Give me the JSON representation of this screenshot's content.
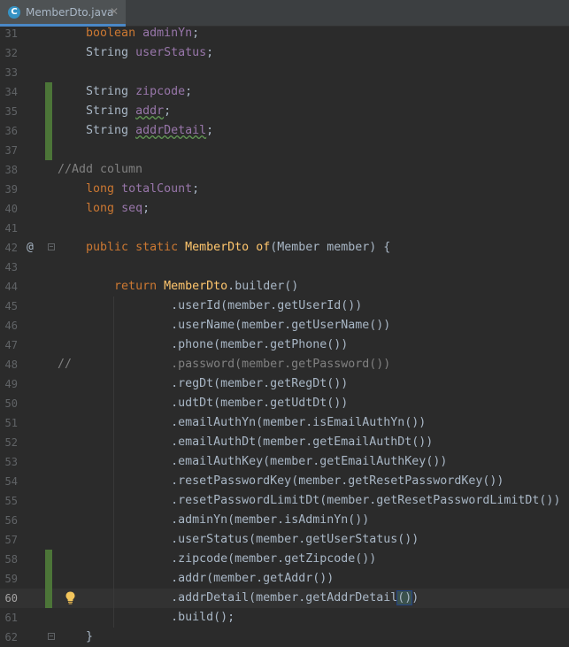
{
  "tab": {
    "filename": "MemberDto.java",
    "icon_letter": "C",
    "close_glyph": "✕"
  },
  "lines": [
    {
      "num": "31",
      "tokens": [
        {
          "t": "    "
        },
        {
          "t": "boolean",
          "c": "kw"
        },
        {
          "t": " "
        },
        {
          "t": "adminYn",
          "c": "fld"
        },
        {
          "t": ";"
        }
      ]
    },
    {
      "num": "32",
      "tokens": [
        {
          "t": "    String "
        },
        {
          "t": "userStatus",
          "c": "fld"
        },
        {
          "t": ";"
        }
      ]
    },
    {
      "num": "33",
      "tokens": []
    },
    {
      "num": "34",
      "change": true,
      "tokens": [
        {
          "t": "    String "
        },
        {
          "t": "zipcode",
          "c": "fld"
        },
        {
          "t": ";"
        }
      ]
    },
    {
      "num": "35",
      "change": true,
      "tokens": [
        {
          "t": "    String "
        },
        {
          "t": "addr",
          "c": "fld wavy"
        },
        {
          "t": ";"
        }
      ]
    },
    {
      "num": "36",
      "change": true,
      "tokens": [
        {
          "t": "    String "
        },
        {
          "t": "addrDetail",
          "c": "fld wavy"
        },
        {
          "t": ";"
        }
      ]
    },
    {
      "num": "37",
      "change": true,
      "tokens": []
    },
    {
      "num": "38",
      "tokens": [
        {
          "t": "//Add column",
          "c": "cmt"
        }
      ]
    },
    {
      "num": "39",
      "tokens": [
        {
          "t": "    "
        },
        {
          "t": "long",
          "c": "kw"
        },
        {
          "t": " "
        },
        {
          "t": "totalCount",
          "c": "fld"
        },
        {
          "t": ";"
        }
      ]
    },
    {
      "num": "40",
      "tokens": [
        {
          "t": "    "
        },
        {
          "t": "long",
          "c": "kw"
        },
        {
          "t": " "
        },
        {
          "t": "seq",
          "c": "fld"
        },
        {
          "t": ";"
        }
      ]
    },
    {
      "num": "41",
      "tokens": []
    },
    {
      "num": "42",
      "gutter": "@",
      "fold": true,
      "tokens": [
        {
          "t": "    "
        },
        {
          "t": "public static",
          "c": "kw"
        },
        {
          "t": " "
        },
        {
          "t": "MemberDto",
          "c": "mth"
        },
        {
          "t": " "
        },
        {
          "t": "of",
          "c": "mth"
        },
        {
          "t": "(Member member) {"
        }
      ]
    },
    {
      "num": "43",
      "tokens": []
    },
    {
      "num": "44",
      "tokens": [
        {
          "t": "        "
        },
        {
          "t": "return",
          "c": "kw"
        },
        {
          "t": " "
        },
        {
          "t": "MemberDto",
          "c": "mth"
        },
        {
          "t": "."
        },
        {
          "t": "builder",
          "c": "call"
        },
        {
          "t": "()"
        }
      ]
    },
    {
      "num": "45",
      "tokens": [
        {
          "t": "                ."
        },
        {
          "t": "userId",
          "c": "call"
        },
        {
          "t": "(member."
        },
        {
          "t": "getUserId",
          "c": "call"
        },
        {
          "t": "())"
        }
      ]
    },
    {
      "num": "46",
      "tokens": [
        {
          "t": "                ."
        },
        {
          "t": "userName",
          "c": "call"
        },
        {
          "t": "(member."
        },
        {
          "t": "getUserName",
          "c": "call"
        },
        {
          "t": "())"
        }
      ]
    },
    {
      "num": "47",
      "tokens": [
        {
          "t": "                ."
        },
        {
          "t": "phone",
          "c": "call"
        },
        {
          "t": "(member."
        },
        {
          "t": "getPhone",
          "c": "call"
        },
        {
          "t": "())"
        }
      ]
    },
    {
      "num": "48",
      "tokens": [
        {
          "t": "//              .password(member.getPassword())",
          "c": "cmt"
        }
      ]
    },
    {
      "num": "49",
      "tokens": [
        {
          "t": "                ."
        },
        {
          "t": "regDt",
          "c": "call"
        },
        {
          "t": "(member."
        },
        {
          "t": "getRegDt",
          "c": "call"
        },
        {
          "t": "())"
        }
      ]
    },
    {
      "num": "50",
      "tokens": [
        {
          "t": "                ."
        },
        {
          "t": "udtDt",
          "c": "call"
        },
        {
          "t": "(member."
        },
        {
          "t": "getUdtDt",
          "c": "call"
        },
        {
          "t": "())"
        }
      ]
    },
    {
      "num": "51",
      "tokens": [
        {
          "t": "                ."
        },
        {
          "t": "emailAuthYn",
          "c": "call"
        },
        {
          "t": "(member."
        },
        {
          "t": "isEmailAuthYn",
          "c": "call"
        },
        {
          "t": "())"
        }
      ]
    },
    {
      "num": "52",
      "tokens": [
        {
          "t": "                ."
        },
        {
          "t": "emailAuthDt",
          "c": "call"
        },
        {
          "t": "(member."
        },
        {
          "t": "getEmailAuthDt",
          "c": "call"
        },
        {
          "t": "())"
        }
      ]
    },
    {
      "num": "53",
      "tokens": [
        {
          "t": "                ."
        },
        {
          "t": "emailAuthKey",
          "c": "call"
        },
        {
          "t": "(member."
        },
        {
          "t": "getEmailAuthKey",
          "c": "call"
        },
        {
          "t": "())"
        }
      ]
    },
    {
      "num": "54",
      "tokens": [
        {
          "t": "                ."
        },
        {
          "t": "resetPasswordKey",
          "c": "call"
        },
        {
          "t": "(member."
        },
        {
          "t": "getResetPasswordKey",
          "c": "call"
        },
        {
          "t": "())"
        }
      ]
    },
    {
      "num": "55",
      "tokens": [
        {
          "t": "                ."
        },
        {
          "t": "resetPasswordLimitDt",
          "c": "call"
        },
        {
          "t": "(member."
        },
        {
          "t": "getResetPasswordLimitDt",
          "c": "call"
        },
        {
          "t": "())"
        }
      ]
    },
    {
      "num": "56",
      "tokens": [
        {
          "t": "                ."
        },
        {
          "t": "adminYn",
          "c": "call"
        },
        {
          "t": "(member."
        },
        {
          "t": "isAdminYn",
          "c": "call"
        },
        {
          "t": "())"
        }
      ]
    },
    {
      "num": "57",
      "tokens": [
        {
          "t": "                ."
        },
        {
          "t": "userStatus",
          "c": "call"
        },
        {
          "t": "(member."
        },
        {
          "t": "getUserStatus",
          "c": "call"
        },
        {
          "t": "())"
        }
      ]
    },
    {
      "num": "58",
      "change": true,
      "tokens": [
        {
          "t": "                ."
        },
        {
          "t": "zipcode",
          "c": "call"
        },
        {
          "t": "(member."
        },
        {
          "t": "getZipcode",
          "c": "call"
        },
        {
          "t": "())"
        }
      ]
    },
    {
      "num": "59",
      "change": true,
      "tokens": [
        {
          "t": "                ."
        },
        {
          "t": "addr",
          "c": "call"
        },
        {
          "t": "(member."
        },
        {
          "t": "getAddr",
          "c": "call"
        },
        {
          "t": "())"
        }
      ]
    },
    {
      "num": "60",
      "change": true,
      "caret": true,
      "bulb": true,
      "tokens": [
        {
          "t": "                ."
        },
        {
          "t": "addrDetail",
          "c": "call"
        },
        {
          "t": "(member."
        },
        {
          "t": "getAddrDetail",
          "c": "call"
        },
        {
          "t": "()",
          "c": "sel"
        },
        {
          "t": ")"
        }
      ]
    },
    {
      "num": "61",
      "tokens": [
        {
          "t": "                ."
        },
        {
          "t": "build",
          "c": "call"
        },
        {
          "t": "();"
        }
      ]
    },
    {
      "num": "62",
      "fold": true,
      "tokens": [
        {
          "t": "    }"
        }
      ]
    }
  ],
  "colors": {
    "background": "#2b2b2b",
    "keyword": "#cc7832",
    "field": "#9876aa",
    "method": "#ffc66d",
    "comment": "#808080",
    "change_marker": "#4c7538",
    "tab_underline": "#4a88c7"
  },
  "icons": {
    "bulb": "lightbulb-icon",
    "fold": "fold-marker-icon",
    "override": "implements-at-icon"
  }
}
